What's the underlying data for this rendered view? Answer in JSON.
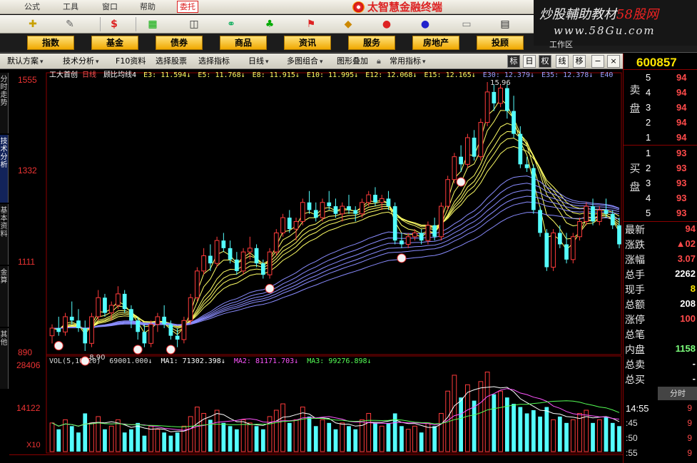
{
  "menu": {
    "items": [
      "公式",
      "工具",
      "窗口",
      "帮助"
    ],
    "trade": "委托"
  },
  "app_title": "太智慧金融终端",
  "watermark": {
    "line1_a": "炒股輔助教材",
    "line1_b": "58股网",
    "line2": "www.58Gu.com"
  },
  "workspace": "工作区",
  "categories": [
    "指数",
    "基金",
    "债券",
    "商品",
    "资讯",
    "服务",
    "房地产",
    "投顾"
  ],
  "funcbar": {
    "items": [
      "默认方案",
      "技术分析",
      "F10资料",
      "选择股票",
      "选择指标",
      "日线",
      "多图组合",
      "图形叠加",
      "常用指标"
    ],
    "buttons": [
      "标",
      "日",
      "权",
      "线",
      "移"
    ]
  },
  "left_tabs": [
    "分时走势",
    "技术分析",
    "基本资料",
    "金算",
    "其他"
  ],
  "chart": {
    "y_ticks": [
      "1555",
      "1332",
      "1111",
      "890"
    ],
    "legend_main": {
      "lead": "工大首创",
      "period": "日线",
      "indicator": "顾比均线4",
      "items": [
        "E3: 11.594↓",
        "E5: 11.768↓",
        "E8: 11.915↓",
        "E10: 11.995↓",
        "E12: 12.068↓",
        "E15: 12.165↓",
        "E30: 12.379↓",
        "E35: 12.378↓",
        "E40"
      ]
    },
    "high_label": "15.96",
    "low_label": "8.90",
    "vol_legend": {
      "name": "VOL(5,10,20)",
      "vol": "69001.000↓",
      "ma1": "MA1: 71302.398↓",
      "ma2": "MA2: 81171.703↓",
      "ma3": "MA3: 99276.898↓"
    },
    "vol_ticks": [
      "28406",
      "14122",
      "X10"
    ],
    "colors": {
      "up": "#ff3b3b",
      "down": "#54ffff",
      "ema_short": "#ffff66",
      "ema_long": "#8a8cff",
      "ma1": "#ffffff",
      "ma2": "#ff55ff",
      "ma3": "#55ff55"
    }
  },
  "chart_data": {
    "type": "candlestick",
    "ohlc": [
      [
        9.3,
        9.6,
        9.1,
        9.5
      ],
      [
        9.5,
        9.8,
        9.3,
        9.4
      ],
      [
        9.4,
        9.9,
        9.3,
        9.8
      ],
      [
        9.8,
        10.2,
        9.6,
        9.7
      ],
      [
        9.7,
        10.0,
        9.4,
        9.5
      ],
      [
        9.5,
        9.7,
        8.9,
        9.1
      ],
      [
        9.1,
        9.9,
        9.0,
        9.8
      ],
      [
        9.8,
        10.5,
        9.7,
        10.3
      ],
      [
        10.3,
        10.4,
        9.8,
        9.9
      ],
      [
        9.9,
        10.2,
        9.7,
        10.1
      ],
      [
        10.1,
        10.6,
        10.0,
        10.4
      ],
      [
        10.4,
        10.5,
        9.9,
        10.0
      ],
      [
        10.0,
        10.1,
        9.5,
        9.7
      ],
      [
        9.7,
        9.8,
        9.2,
        9.4
      ],
      [
        9.4,
        9.6,
        9.0,
        9.1
      ],
      [
        9.1,
        9.7,
        9.0,
        9.6
      ],
      [
        9.6,
        9.9,
        9.4,
        9.8
      ],
      [
        9.8,
        10.1,
        9.5,
        9.6
      ],
      [
        9.6,
        9.7,
        9.2,
        9.3
      ],
      [
        9.3,
        9.5,
        9.0,
        9.2
      ],
      [
        9.2,
        9.8,
        9.1,
        9.7
      ],
      [
        9.7,
        10.4,
        9.6,
        10.3
      ],
      [
        10.3,
        11.1,
        10.2,
        11.0
      ],
      [
        11.0,
        11.6,
        10.9,
        11.4
      ],
      [
        11.4,
        11.7,
        11.0,
        11.2
      ],
      [
        11.2,
        11.9,
        11.1,
        11.8
      ],
      [
        11.8,
        12.0,
        11.5,
        11.6
      ],
      [
        11.6,
        11.8,
        11.2,
        11.3
      ],
      [
        11.3,
        11.5,
        10.9,
        11.0
      ],
      [
        11.0,
        11.6,
        10.9,
        11.5
      ],
      [
        11.5,
        11.9,
        11.3,
        11.6
      ],
      [
        11.6,
        11.7,
        11.1,
        11.2
      ],
      [
        11.2,
        11.3,
        10.8,
        10.9
      ],
      [
        10.9,
        11.6,
        10.8,
        11.5
      ],
      [
        11.5,
        12.1,
        11.4,
        12.0
      ],
      [
        12.0,
        12.5,
        11.9,
        12.4
      ],
      [
        12.4,
        12.6,
        12.0,
        12.1
      ],
      [
        12.1,
        12.4,
        11.8,
        12.3
      ],
      [
        12.3,
        12.9,
        12.2,
        12.8
      ],
      [
        12.8,
        13.1,
        12.5,
        12.6
      ],
      [
        12.6,
        12.8,
        12.3,
        12.4
      ],
      [
        12.4,
        12.9,
        12.3,
        12.8
      ],
      [
        12.8,
        13.1,
        12.6,
        12.7
      ],
      [
        12.7,
        12.9,
        12.4,
        12.5
      ],
      [
        12.5,
        12.8,
        12.3,
        12.7
      ],
      [
        12.7,
        13.0,
        12.5,
        12.6
      ],
      [
        12.6,
        12.7,
        12.3,
        12.5
      ],
      [
        12.5,
        12.9,
        12.4,
        12.8
      ],
      [
        12.8,
        13.1,
        12.7,
        13.0
      ],
      [
        13.0,
        13.2,
        12.7,
        12.8
      ],
      [
        12.8,
        13.0,
        12.6,
        12.9
      ],
      [
        12.9,
        13.1,
        12.6,
        12.7
      ],
      [
        12.7,
        12.8,
        11.7,
        11.8
      ],
      [
        11.8,
        12.0,
        11.6,
        11.7
      ],
      [
        11.7,
        12.0,
        11.6,
        11.9
      ],
      [
        11.9,
        12.1,
        11.8,
        12.0
      ],
      [
        12.0,
        12.1,
        11.7,
        11.8
      ],
      [
        11.8,
        12.3,
        11.7,
        12.2
      ],
      [
        12.2,
        12.4,
        11.8,
        11.9
      ],
      [
        11.9,
        12.8,
        11.8,
        12.7
      ],
      [
        12.7,
        13.5,
        12.6,
        13.4
      ],
      [
        13.4,
        14.1,
        13.3,
        14.0
      ],
      [
        14.0,
        14.3,
        13.6,
        13.8
      ],
      [
        13.8,
        14.6,
        13.7,
        14.5
      ],
      [
        14.5,
        14.7,
        13.9,
        14.0
      ],
      [
        14.0,
        15.0,
        13.9,
        14.9
      ],
      [
        14.9,
        15.96,
        14.8,
        15.7
      ],
      [
        15.7,
        15.9,
        15.2,
        15.4
      ],
      [
        15.4,
        15.9,
        15.3,
        15.8
      ],
      [
        15.8,
        15.9,
        15.0,
        15.2
      ],
      [
        15.2,
        15.6,
        14.5,
        14.6
      ],
      [
        14.6,
        14.8,
        13.7,
        13.8
      ],
      [
        13.8,
        14.0,
        13.6,
        13.7
      ],
      [
        13.7,
        13.8,
        12.5,
        12.6
      ],
      [
        12.6,
        12.7,
        11.9,
        12.0
      ],
      [
        12.0,
        12.1,
        11.0,
        11.1
      ],
      [
        11.1,
        12.1,
        11.0,
        12.0
      ],
      [
        12.0,
        12.2,
        11.6,
        11.7
      ],
      [
        11.7,
        12.0,
        11.2,
        11.3
      ],
      [
        11.3,
        12.0,
        11.2,
        11.9
      ],
      [
        11.9,
        12.4,
        11.8,
        12.3
      ],
      [
        12.3,
        12.8,
        12.2,
        12.7
      ],
      [
        12.7,
        12.9,
        12.2,
        12.3
      ],
      [
        12.3,
        12.7,
        12.2,
        12.6
      ],
      [
        12.6,
        12.9,
        12.4,
        12.5
      ],
      [
        12.5,
        12.6,
        12.1,
        12.2
      ],
      [
        12.2,
        12.4,
        11.6,
        11.7
      ]
    ],
    "volumes": [
      9,
      7,
      10,
      8,
      6,
      12,
      9,
      11,
      7,
      8,
      10,
      6,
      7,
      9,
      5,
      8,
      7,
      6,
      5,
      6,
      8,
      11,
      14,
      12,
      10,
      13,
      9,
      8,
      7,
      10,
      9,
      8,
      7,
      11,
      13,
      15,
      9,
      10,
      14,
      11,
      8,
      10,
      9,
      7,
      9,
      8,
      7,
      10,
      12,
      9,
      8,
      9,
      12,
      8,
      7,
      8,
      6,
      9,
      8,
      12,
      19,
      24,
      17,
      21,
      16,
      22,
      25,
      18,
      19,
      17,
      15,
      14,
      12,
      13,
      11,
      14,
      10,
      11,
      9,
      10,
      12,
      13,
      9,
      10,
      11,
      9,
      8
    ],
    "ylim": [
      8.9,
      15.96
    ]
  },
  "orderbook": {
    "side_sell": "卖盘",
    "side_buy": "买盘",
    "sell": [
      {
        "idx": "5",
        "qty": "94"
      },
      {
        "idx": "4",
        "qty": "94"
      },
      {
        "idx": "3",
        "qty": "94"
      },
      {
        "idx": "2",
        "qty": "94"
      },
      {
        "idx": "1",
        "qty": "94"
      }
    ],
    "buy": [
      {
        "idx": "1",
        "qty": "93"
      },
      {
        "idx": "2",
        "qty": "93"
      },
      {
        "idx": "3",
        "qty": "93"
      },
      {
        "idx": "4",
        "qty": "93"
      },
      {
        "idx": "5",
        "qty": "93"
      }
    ]
  },
  "stock_code": "600857",
  "stats": [
    {
      "label": "最新",
      "value": "94",
      "color": "#ff4a4a"
    },
    {
      "label": "涨跌",
      "value": "▲02",
      "color": "#ff4a4a"
    },
    {
      "label": "涨幅",
      "value": "3.07",
      "color": "#ff4a4a"
    },
    {
      "label": "总手",
      "value": "2262",
      "color": "#ffffff"
    },
    {
      "label": "现手",
      "value": "8",
      "color": "#ffe600"
    },
    {
      "label": "总额",
      "value": "208",
      "color": "#ffffff"
    },
    {
      "label": "涨停",
      "value": "100",
      "color": "#ff4a4a"
    },
    {
      "label": "总笔",
      "value": "",
      "color": "#ffffff"
    },
    {
      "label": "内盘",
      "value": "1158",
      "color": "#7cff7c"
    },
    {
      "label": "总卖",
      "value": "-",
      "color": "#ffffff"
    },
    {
      "label": "总买",
      "value": "-",
      "color": "#ffffff"
    }
  ],
  "fenbi_tab": "分时",
  "ticks": [
    {
      "time": "14:55",
      "val": "9"
    },
    {
      "time": ":45",
      "val": "9"
    },
    {
      "time": ":50",
      "val": "9"
    },
    {
      "time": ":55",
      "val": "9"
    }
  ]
}
